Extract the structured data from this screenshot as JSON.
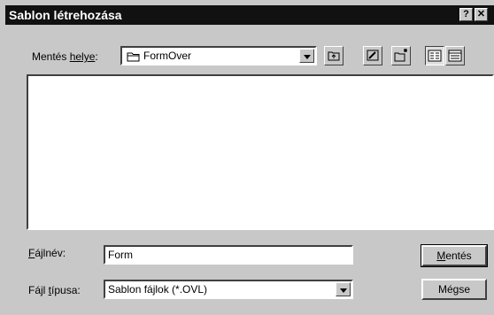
{
  "window": {
    "title": "Sablon létrehozása",
    "help_label": "?",
    "close_label": "✕"
  },
  "location": {
    "label_prefix": "Mentés ",
    "label_underlined": "helye",
    "label_suffix": ":",
    "value": "FormOver"
  },
  "toolbar": {
    "icons": [
      "up-folder-icon",
      "desktop-icon",
      "new-folder-icon",
      "list-view-icon",
      "details-view-icon"
    ]
  },
  "filename": {
    "label_underlined": "F",
    "label_rest": "ájlnév:",
    "value": "Form"
  },
  "filetype": {
    "label_prefix": "Fájl ",
    "label_underlined": "t",
    "label_rest": "ípusa:",
    "value": "Sablon fájlok (*.OVL)"
  },
  "buttons": {
    "save_underlined": "M",
    "save_rest": "entés",
    "cancel": "Mégse"
  },
  "colors": {
    "titlebar": "#111111",
    "face": "#c8c8c8",
    "field": "#ffffff"
  }
}
